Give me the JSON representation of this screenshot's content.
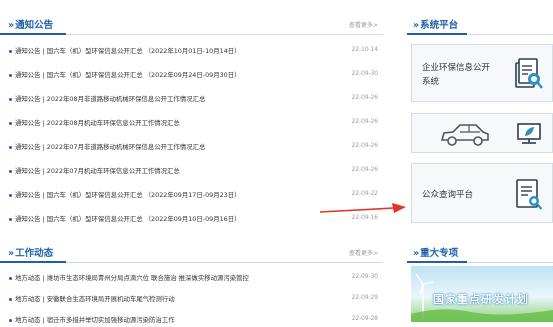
{
  "notice": {
    "title": "通知公告",
    "more": "查看更多>",
    "items": [
      {
        "text": "通知公告 | 国六车（机）型环保信息公开汇总 （2022年10月01日-10月14日）",
        "date": "22-10-14"
      },
      {
        "text": "通知公告 | 国六车（机）型环保信息公开汇总 （2022年09月24日-09月30日）",
        "date": "22-09-30"
      },
      {
        "text": "通知公告 | 2022年08月非道路移动机械环保信息公开工作情况汇总",
        "date": "22-09-26"
      },
      {
        "text": "通知公告 | 2022年08月机动车环保信息公开工作情况汇总",
        "date": "22-09-26"
      },
      {
        "text": "通知公告 | 2022年07月非道路移动机械环保信息公开工作情况汇总",
        "date": "22-09-26"
      },
      {
        "text": "通知公告 | 2022年07月机动车环保信息公开工作情况汇总",
        "date": "22-09-26"
      },
      {
        "text": "通知公告 | 国六车（机）型环保信息公开汇总 （2022年09月17日-09月23日）",
        "date": "22-09-22"
      },
      {
        "text": "通知公告 | 国六车（机）型环保信息公开汇总 （2022年09月10日-09月16日）",
        "date": "22-09-16"
      }
    ]
  },
  "work": {
    "title": "工作动态",
    "more": "查看更多>",
    "items": [
      {
        "text": "地方动态 | 潍坊市生态环境局青州分局点滴穴位 联合施治 推深做实移动源污染管控",
        "date": "22-09-30"
      },
      {
        "text": "地方动态 | 安徽联合生态环境局开展机动车尾气检测行动",
        "date": "22-09-29"
      },
      {
        "text": "地方动态 | 宿迁市多措并举切实加强移动源污染防治工作",
        "date": "22-09-28"
      }
    ]
  },
  "platform": {
    "title": "系统平台",
    "cards": [
      {
        "label_line1": "企业环保信息公开",
        "label_line2": "系统",
        "icon": "document-search-icon"
      },
      {
        "label_line1": "",
        "label_line2": "",
        "icon": "car-icon"
      },
      {
        "label_line1": "公众查询平台",
        "label_line2": "",
        "icon": "document-search-icon"
      }
    ]
  },
  "special": {
    "title": "重大专项",
    "banner_text": "国家重点研发计划"
  },
  "colors": {
    "accent": "#1f5fa8",
    "arrow": "#e5322d",
    "card_bg": "#f7f8fa",
    "icon_teal": "#2d8fc4"
  }
}
